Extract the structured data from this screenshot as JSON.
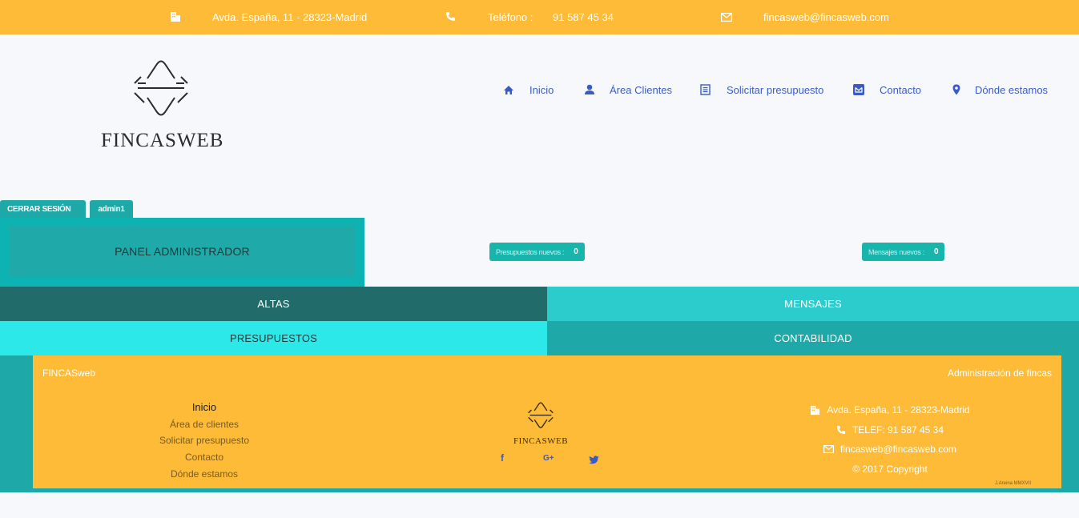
{
  "topbar": {
    "address": "Avda. España, 11 - 28323-Madrid",
    "phone_label": "Teléfono :",
    "phone": "91 587 45 34",
    "email": "fincasweb@fincasweb.com"
  },
  "logo": {
    "text": "FINCASWEB"
  },
  "nav": {
    "items": [
      {
        "label": "Inicio",
        "icon": "home-icon"
      },
      {
        "label": "Área Clientes",
        "icon": "user-icon"
      },
      {
        "label": "Solicitar presupuesto",
        "icon": "document-icon"
      },
      {
        "label": "Contacto",
        "icon": "envelope-icon"
      },
      {
        "label": "Dónde estamos",
        "icon": "map-marker-icon"
      }
    ]
  },
  "session": {
    "logout": "CERRAR SESIÓN",
    "user": "admin1"
  },
  "panel": {
    "title": "PANEL ADMINISTRADOR",
    "budgets_label": "Presupuestos nuevos :",
    "budgets_count": "0",
    "messages_label": "Mensajes nuevos :",
    "messages_count": "0"
  },
  "menu": {
    "altas": "ALTAS",
    "mensajes": "MENSAJES",
    "presupuestos": "PRESUPUESTOS",
    "contabilidad": "CONTABILIDAD"
  },
  "footer": {
    "brand": "FINCASweb",
    "tagline": "Administración de fincas",
    "links": [
      "Inicio",
      "Área de clientes",
      "Solicitar presupuesto",
      "Contacto",
      "Dónde estamos"
    ],
    "logo_text": "FINCASWEB",
    "social": {
      "facebook": "f",
      "google": "G+",
      "twitter": "twitter"
    },
    "address": "Avda. España, 11 - 28323-Madrid",
    "phone": "TELEF: 91 587 45 34",
    "email": "fincasweb@fincasweb.com",
    "copyright": "© 2017 Copyright",
    "signature": "J.Areina MMXVII"
  },
  "colors": {
    "topbar": "#fdbb38",
    "teal": "#1fa8a8",
    "altas": "#226b6b",
    "mensajes": "#2ccccc",
    "presupuestos": "#2de8e8",
    "contabilidad": "#1fa8a8",
    "nav": "#3b5bc4"
  }
}
